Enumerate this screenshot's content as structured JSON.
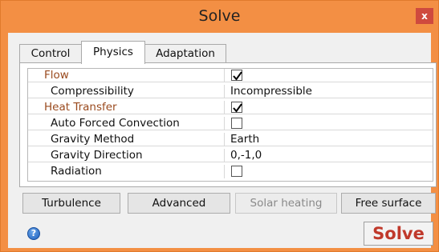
{
  "window": {
    "title": "Solve",
    "close_label": "x"
  },
  "tabs": [
    {
      "label": "Control",
      "active": false
    },
    {
      "label": "Physics",
      "active": true
    },
    {
      "label": "Adaptation",
      "active": false
    }
  ],
  "properties": [
    {
      "name": "Flow",
      "kind": "category",
      "value_type": "checkbox",
      "checked": true
    },
    {
      "name": "Compressibility",
      "kind": "item",
      "value_type": "text",
      "value": "Incompressible"
    },
    {
      "name": "Heat Transfer",
      "kind": "category",
      "value_type": "checkbox",
      "checked": true
    },
    {
      "name": "Auto Forced Convection",
      "kind": "item",
      "value_type": "checkbox",
      "checked": false
    },
    {
      "name": "Gravity Method",
      "kind": "item",
      "value_type": "text",
      "value": "Earth"
    },
    {
      "name": "Gravity Direction",
      "kind": "item",
      "value_type": "text",
      "value": "0,-1,0"
    },
    {
      "name": "Radiation",
      "kind": "item",
      "value_type": "checkbox",
      "checked": false
    }
  ],
  "buttons": {
    "turbulence": "Turbulence",
    "advanced": "Advanced",
    "solar_heating": "Solar heating",
    "free_surface": "Free surface"
  },
  "footer": {
    "help_label": "?",
    "solve_label": "Solve"
  },
  "colors": {
    "frame": "#f38f44",
    "category_text": "#9a4a1e",
    "solve_text": "#c0392b",
    "close_button": "#cf4a3e"
  }
}
